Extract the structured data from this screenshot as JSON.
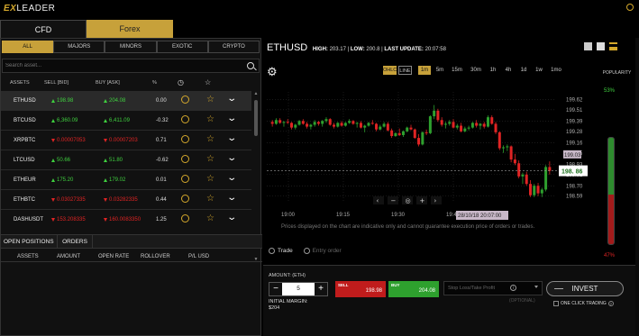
{
  "app": {
    "logo_prefix": "EX",
    "logo_rest": "LEADER"
  },
  "main_tabs": [
    "CFD",
    "Forex"
  ],
  "filters": [
    "ALL",
    "MAJORS",
    "MINORS",
    "EXOTIC",
    "CRYPTO"
  ],
  "search": {
    "placeholder": "Search asset..."
  },
  "columns": {
    "assets": "ASSETS",
    "sell": "SELL [BID]",
    "buy": "BUY [ASK]",
    "pct": "%"
  },
  "assets": [
    {
      "symbol": "ETHUSD",
      "sell": "198.98",
      "buy": "204.08",
      "pct": "0.00",
      "sell_dir": "up",
      "buy_dir": "up"
    },
    {
      "symbol": "BTCUSD",
      "sell": "6,360.09",
      "buy": "6,411.09",
      "pct": "-0.32",
      "sell_dir": "up",
      "buy_dir": "up"
    },
    {
      "symbol": "XRPBTC",
      "sell": "0.00007053",
      "buy": "0.00007203",
      "pct": "0.71",
      "sell_dir": "down",
      "buy_dir": "down"
    },
    {
      "symbol": "LTCUSD",
      "sell": "50.66",
      "buy": "51.80",
      "pct": "-0.62",
      "sell_dir": "up",
      "buy_dir": "up"
    },
    {
      "symbol": "ETHEUR",
      "sell": "175.20",
      "buy": "179.02",
      "pct": "0.01",
      "sell_dir": "up",
      "buy_dir": "up"
    },
    {
      "symbol": "ETHBTC",
      "sell": "0.03027335",
      "buy": "0.03282335",
      "pct": "0.44",
      "sell_dir": "down",
      "buy_dir": "down"
    },
    {
      "symbol": "DASHUSDT",
      "sell": "153.208335",
      "buy": "160.0083350",
      "pct": "1.25",
      "sell_dir": "down",
      "buy_dir": "down"
    }
  ],
  "position_tabs": [
    "OPEN POSITIONS",
    "ORDERS"
  ],
  "position_columns": [
    "ASSETS",
    "AMOUNT",
    "OPEN RATE",
    "ROLLOVER",
    "P/L USD"
  ],
  "chart_header": {
    "symbol": "ETHUSD",
    "high_label": "HIGH:",
    "high": "203.17",
    "low_label": "LOW:",
    "low": "200.8",
    "update_label": "LAST UPDATE:",
    "update": "20:07:58"
  },
  "chart_types": [
    "OHLC",
    "LINE"
  ],
  "timeframes": [
    "1m",
    "5m",
    "15m",
    "30m",
    "1h",
    "4h",
    "1d",
    "1w",
    "1mo"
  ],
  "active_timeframe": "1m",
  "popularity": {
    "label": "POPULARITY",
    "buy_pct": "53%",
    "sell_pct": "47%",
    "buy_fraction": 0.53
  },
  "chart_data": {
    "type": "candlestick",
    "x_ticks": [
      "19:00",
      "19:15",
      "19:30",
      "19:45"
    ],
    "y_ticks": [
      199.62,
      199.51,
      199.39,
      199.28,
      199.16,
      199.05,
      198.93,
      198.82,
      198.7,
      198.59
    ],
    "y_tick_labels": [
      "199.62",
      "199.51",
      "199.39",
      "199.28",
      "199.16",
      "199.05",
      "198.93",
      "198.82",
      "198.70",
      "198.59"
    ],
    "ylim": [
      198.53,
      199.7
    ],
    "current_price": "198. 86",
    "current_price_value": 198.86,
    "ask_label": "199.03",
    "ask_value": 199.03,
    "crosshair_time": "28/10/18 20:07:00",
    "grid": true,
    "up_color": "#2ea02e",
    "down_color": "#e02424",
    "candles": [
      [
        199.38,
        199.4,
        199.33,
        199.36
      ],
      [
        199.36,
        199.42,
        199.35,
        199.4
      ],
      [
        199.4,
        199.42,
        199.36,
        199.37
      ],
      [
        199.37,
        199.39,
        199.33,
        199.38
      ],
      [
        199.38,
        199.41,
        199.36,
        199.37
      ],
      [
        199.37,
        199.38,
        199.3,
        199.32
      ],
      [
        199.32,
        199.36,
        199.3,
        199.35
      ],
      [
        199.35,
        199.4,
        199.34,
        199.39
      ],
      [
        199.39,
        199.41,
        199.35,
        199.36
      ],
      [
        199.36,
        199.38,
        199.31,
        199.33
      ],
      [
        199.33,
        199.36,
        199.3,
        199.35
      ],
      [
        199.35,
        199.4,
        199.33,
        199.38
      ],
      [
        199.38,
        199.39,
        199.34,
        199.36
      ],
      [
        199.36,
        199.4,
        199.33,
        199.39
      ],
      [
        199.39,
        199.43,
        199.37,
        199.41
      ],
      [
        199.41,
        199.42,
        199.34,
        199.35
      ],
      [
        199.35,
        199.37,
        199.31,
        199.33
      ],
      [
        199.33,
        199.38,
        199.32,
        199.37
      ],
      [
        199.37,
        199.39,
        199.33,
        199.34
      ],
      [
        199.34,
        199.38,
        199.33,
        199.37
      ],
      [
        199.37,
        199.41,
        199.36,
        199.39
      ],
      [
        199.39,
        199.4,
        199.35,
        199.36
      ],
      [
        199.36,
        199.38,
        199.32,
        199.37
      ],
      [
        199.37,
        199.39,
        199.31,
        199.32
      ],
      [
        199.32,
        199.35,
        199.27,
        199.34
      ],
      [
        199.34,
        199.38,
        199.33,
        199.37
      ],
      [
        199.37,
        199.4,
        199.35,
        199.36
      ],
      [
        199.36,
        199.37,
        199.28,
        199.3
      ],
      [
        199.3,
        199.35,
        199.29,
        199.33
      ],
      [
        199.33,
        199.38,
        199.32,
        199.36
      ],
      [
        199.36,
        199.38,
        199.28,
        199.29
      ],
      [
        199.29,
        199.31,
        199.21,
        199.23
      ],
      [
        199.23,
        199.27,
        199.22,
        199.26
      ],
      [
        199.26,
        199.31,
        199.23,
        199.24
      ],
      [
        199.24,
        199.29,
        199.22,
        199.28
      ],
      [
        199.28,
        199.33,
        199.27,
        199.32
      ],
      [
        199.32,
        199.35,
        199.29,
        199.3
      ],
      [
        199.3,
        199.31,
        199.2,
        199.21
      ],
      [
        199.21,
        199.25,
        199.12,
        199.14
      ],
      [
        199.14,
        199.28,
        199.13,
        199.27
      ],
      [
        199.27,
        199.3,
        199.24,
        199.26
      ],
      [
        199.26,
        199.45,
        199.25,
        199.44
      ],
      [
        199.44,
        199.56,
        199.41,
        199.5
      ],
      [
        199.5,
        199.52,
        199.38,
        199.4
      ],
      [
        199.4,
        199.43,
        199.33,
        199.35
      ],
      [
        199.35,
        199.38,
        199.31,
        199.36
      ],
      [
        199.36,
        199.4,
        199.34,
        199.38
      ],
      [
        199.38,
        199.41,
        199.31,
        199.32
      ],
      [
        199.32,
        199.36,
        199.3,
        199.34
      ],
      [
        199.34,
        199.37,
        199.27,
        199.28
      ],
      [
        199.28,
        199.33,
        199.27,
        199.31
      ],
      [
        199.31,
        199.34,
        199.29,
        199.32
      ],
      [
        199.32,
        199.38,
        199.31,
        199.37
      ],
      [
        199.37,
        199.4,
        199.32,
        199.34
      ],
      [
        199.34,
        199.37,
        199.3,
        199.36
      ],
      [
        199.36,
        199.38,
        199.31,
        199.33
      ],
      [
        199.33,
        199.45,
        199.32,
        199.43
      ],
      [
        199.43,
        199.45,
        199.35,
        199.36
      ],
      [
        199.36,
        199.38,
        199.25,
        199.27
      ],
      [
        199.27,
        199.28,
        199.08,
        199.1
      ],
      [
        199.1,
        199.13,
        199.05,
        199.11
      ],
      [
        199.11,
        199.14,
        199.07,
        199.12
      ],
      [
        199.12,
        199.13,
        198.95,
        198.98
      ],
      [
        198.98,
        199.04,
        198.92,
        198.94
      ],
      [
        198.94,
        198.97,
        198.78,
        198.8
      ],
      [
        198.8,
        198.84,
        198.72,
        198.82
      ],
      [
        198.82,
        198.85,
        198.7,
        198.72
      ],
      [
        198.72,
        198.76,
        198.58,
        198.6
      ],
      [
        198.6,
        198.72,
        198.58,
        198.7
      ],
      [
        198.7,
        198.73,
        198.59,
        198.62
      ],
      [
        198.62,
        198.68,
        198.58,
        198.66
      ],
      [
        198.66,
        198.92,
        198.64,
        198.9
      ],
      [
        198.9,
        198.96,
        198.82,
        198.86
      ]
    ]
  },
  "disclaimer": "Prices displayed on the chart are indicative only and cannot guarantee execution price of orders or trades.",
  "order_types": [
    "Trade",
    "Entry order"
  ],
  "trade": {
    "amount_label": "AMOUNT: (ETH)",
    "amount": "5",
    "minus": "−",
    "plus": "+",
    "margin_label": "INITIAL MARGIN:",
    "margin": "$204",
    "sell_label": "SELL",
    "sell_price": "198.98",
    "buy_label": "BUY",
    "buy_price": "204.08",
    "stoploss_placeholder": "Stop Loss/Take Profit",
    "optional": "(OPTIONAL)",
    "invest": "INVEST",
    "one_click": "ONE CLICK TRADING"
  }
}
